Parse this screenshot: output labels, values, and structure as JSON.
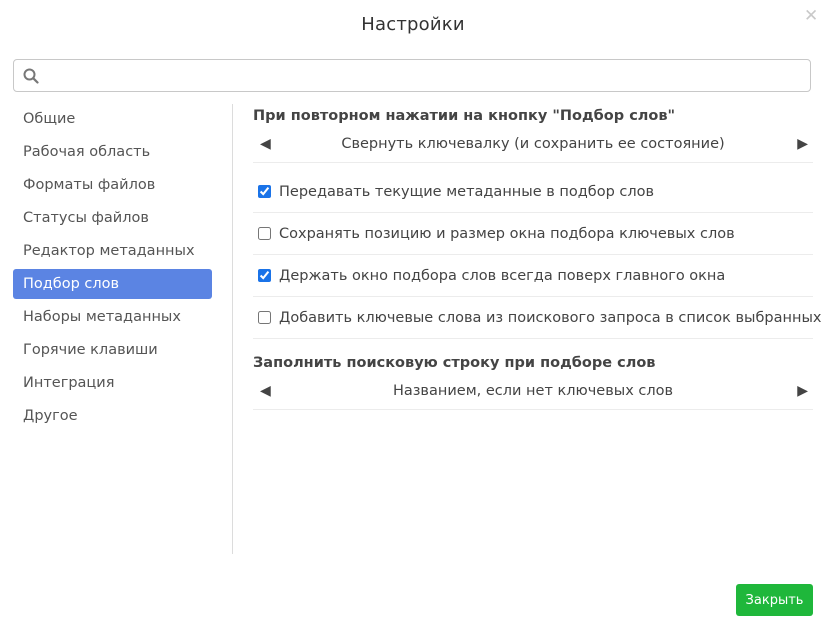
{
  "dialog": {
    "title": "Настройки",
    "close_symbol": "✕"
  },
  "search": {
    "placeholder": "",
    "value": ""
  },
  "sidebar": {
    "items": [
      {
        "label": "Общие"
      },
      {
        "label": "Рабочая область"
      },
      {
        "label": "Форматы файлов"
      },
      {
        "label": "Статусы файлов"
      },
      {
        "label": "Редактор метаданных"
      },
      {
        "label": "Подбор слов",
        "active": true
      },
      {
        "label": "Наборы метаданных"
      },
      {
        "label": "Горячие клавиши"
      },
      {
        "label": "Интеграция"
      },
      {
        "label": "Другое"
      }
    ]
  },
  "content": {
    "repeat_press": {
      "title": "При повторном нажатии на кнопку \"Подбор слов\"",
      "value": "Свернуть ключевалку (и сохранить ее состояние)"
    },
    "checkboxes": [
      {
        "label": "Передавать текущие метаданные в подбор слов",
        "checked": true
      },
      {
        "label": "Сохранять позицию и размер окна подбора ключевых слов",
        "checked": false
      },
      {
        "label": "Держать окно подбора слов всегда поверх главного окна",
        "checked": true
      },
      {
        "label": "Добавить ключевые слова из поискового запроса в список выбранных",
        "checked": false
      }
    ],
    "fill_search": {
      "title": "Заполнить поисковую строку при подборе слов",
      "value": "Названием, если нет ключевых слов"
    }
  },
  "footer": {
    "close_label": "Закрыть"
  },
  "colors": {
    "accent": "#5b84e3",
    "primary_button": "#1fb73b"
  }
}
